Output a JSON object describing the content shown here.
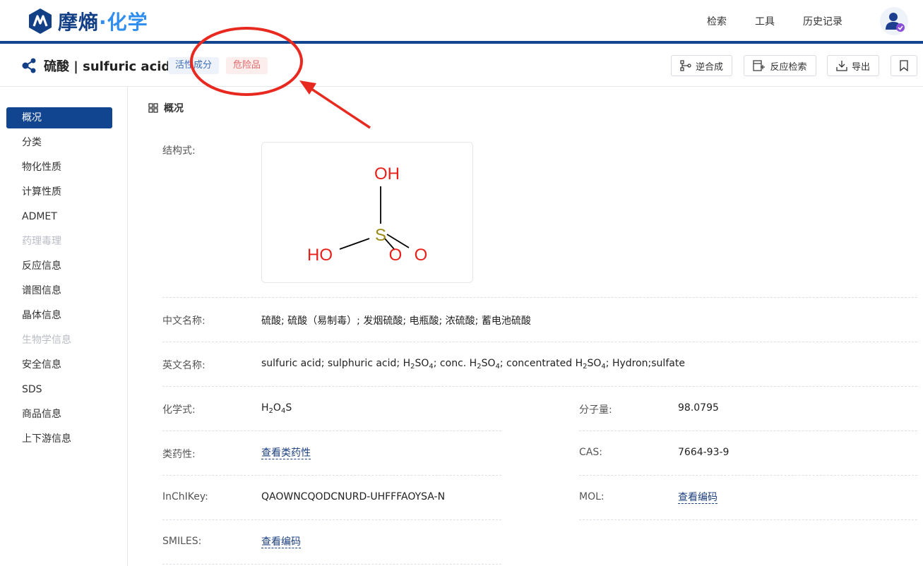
{
  "brand": {
    "name_main": "摩熵",
    "name_dot": "·",
    "name_accent": "化学"
  },
  "topnav": [
    "检索",
    "工具",
    "历史记录"
  ],
  "compound": {
    "title": "硫酸 | sulfuric acid",
    "tags": [
      "活性成分",
      "危险品"
    ]
  },
  "actions": {
    "retro": "逆合成",
    "reaction_search": "反应检索",
    "export": "导出"
  },
  "sidebar": [
    {
      "label": "概况",
      "state": "active"
    },
    {
      "label": "分类",
      "state": "normal"
    },
    {
      "label": "物化性质",
      "state": "normal"
    },
    {
      "label": "计算性质",
      "state": "normal"
    },
    {
      "label": "ADMET",
      "state": "normal"
    },
    {
      "label": "药理毒理",
      "state": "disabled"
    },
    {
      "label": "反应信息",
      "state": "normal"
    },
    {
      "label": "谱图信息",
      "state": "normal"
    },
    {
      "label": "晶体信息",
      "state": "normal"
    },
    {
      "label": "生物学信息",
      "state": "disabled"
    },
    {
      "label": "安全信息",
      "state": "normal"
    },
    {
      "label": "SDS",
      "state": "normal"
    },
    {
      "label": "商品信息",
      "state": "normal"
    },
    {
      "label": "上下游信息",
      "state": "normal"
    }
  ],
  "overview": {
    "heading": "概况",
    "structure_label": "结构式:",
    "structure_atoms": {
      "top": "OH",
      "center": "S",
      "left": "HO",
      "o1": "O",
      "o2": "O"
    },
    "cn_name_label": "中文名称:",
    "cn_name": "硫酸; 硫酸（易制毒）; 发烟硫酸; 电瓶酸; 浓硫酸; 蓄电池硫酸",
    "en_name_label": "英文名称:",
    "en_name_parts": [
      "sulfuric acid; sulphuric acid; H",
      "2",
      "SO",
      "4",
      "; conc. H",
      "2",
      "SO",
      "4",
      "; concentrated H",
      "2",
      "SO",
      "4",
      "; Hydron;sulfate"
    ],
    "formula_label": "化学式:",
    "formula_parts": [
      "H",
      "2",
      "O",
      "4",
      "S"
    ],
    "mw_label": "分子量:",
    "mw": "98.0795",
    "druglike_label": "类药性:",
    "druglike_link": "查看类药性",
    "cas_label": "CAS:",
    "cas": "7664-93-9",
    "inchikey_label": "InChIKey:",
    "inchikey": "QAOWNCQODCNURD-UHFFFAOYSA-N",
    "mol_label": "MOL:",
    "mol_link": "查看编码",
    "smiles_label": "SMILES:",
    "smiles_link": "查看编码"
  },
  "colors": {
    "brand": "#114590",
    "accent": "#2f8ef0",
    "annotation": "#e8291f",
    "atom_o": "#e8201a",
    "atom_s": "#9b8a16"
  }
}
